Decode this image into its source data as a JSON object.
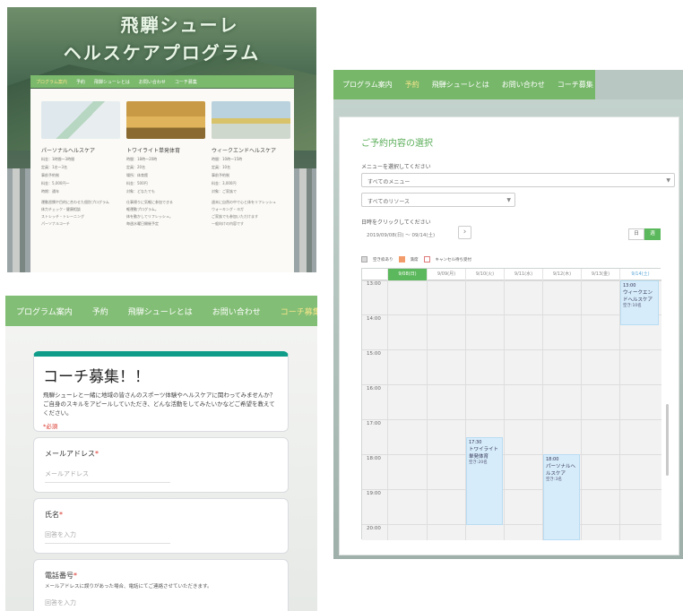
{
  "panel1": {
    "hero_line1": "飛騨シューレ",
    "hero_line2": "ヘルスケアプログラム",
    "nav": [
      "プログラム案内",
      "予約",
      "飛騨シューレとは",
      "お問い合わせ",
      "コーチ募集"
    ],
    "cards": [
      {
        "title": "パーソナルヘルスケア",
        "info": [
          "料金：1時間〜3時間",
          "定員：1名〜3名",
          "事前予約制",
          "料金：5,000円〜",
          "時期：通年"
        ],
        "desc": [
          "運動習慣や目的に合わせた個別プログラム",
          "体力チェック・健康相談",
          "ストレッチ・トレーニング",
          "パーソナルコーチ"
        ]
      },
      {
        "title": "トワイライト単発体育",
        "info": [
          "時間：18時〜20時",
          "定員：20名",
          "場所：体育館",
          "料金：500円",
          "対象：どなたでも"
        ],
        "desc": [
          "仕事帰りに気軽に参加できる",
          "軽運動プログラム。",
          "体を動かしてリフレッシュ。",
          "毎週水曜日開催予定"
        ]
      },
      {
        "title": "ウィークエンドヘルスケア",
        "info": [
          "時間：10時〜15時",
          "定員：10名",
          "事前予約制",
          "料金：3,000円",
          "対象：ご家族で"
        ],
        "desc": [
          "週末に自然の中で心と体をリフレッシュ",
          "ウォーキング・ヨガ",
          "ご家族でも参加いただけます",
          "一般向けの内容です"
        ]
      }
    ]
  },
  "panel2": {
    "nav": [
      "プログラム案内",
      "予約",
      "飛騨シューレとは",
      "お問い合わせ",
      "コーチ募集"
    ],
    "form_title": "コーチ募集！！",
    "form_desc": "飛騨シューレと一緒に地域の皆さんのスポーツ体験やヘルスケアに関わってみませんか？ ご自身のスキルをアピールしていただき、どんな活動をしてみたいかなどご希望を教えてください。",
    "required_note": "*必須",
    "fields": [
      {
        "label": "メールアドレス",
        "required": "*",
        "placeholder": "メールアドレス",
        "hint": ""
      },
      {
        "label": "氏名",
        "required": "*",
        "placeholder": "回答を入力",
        "hint": ""
      },
      {
        "label": "電話番号",
        "required": "*",
        "placeholder": "回答を入力",
        "hint": "メールアドレスに誤りがあった場合、電話にてご連絡させていただきます。"
      }
    ]
  },
  "panel3": {
    "nav": [
      "プログラム案内",
      "予約",
      "飛騨シューレとは",
      "お問い合わせ",
      "コーチ募集"
    ],
    "heading": "ご予約内容の選択",
    "menu_label": "メニューを選択してください",
    "menu_select": "すべてのメニュー",
    "resource_select": "すべてのリソース",
    "date_label": "日時をクリックしてください",
    "date_range": "2019/09/08(日) 〜 09/14(土)",
    "view_day": "日",
    "view_week": "週",
    "legend": [
      "空き枠あり",
      "満席",
      "キャンセル待ち受付"
    ],
    "days": [
      "9/08(日)",
      "9/09(月)",
      "9/10(火)",
      "9/11(水)",
      "9/12(木)",
      "9/13(金)",
      "9/14(土)"
    ],
    "times": [
      "13:00",
      "14:00",
      "15:00",
      "16:00",
      "17:00",
      "18:00",
      "19:00",
      "20:00"
    ],
    "events": [
      {
        "time": "13:00",
        "title": "ウィークエンドヘルスケア",
        "note": "空き:10名"
      },
      {
        "time": "17:30",
        "title": "トワイライト単発体育",
        "note": "空き:20名"
      },
      {
        "time": "18:00",
        "title": "パーソナルヘルスケア",
        "note": "空き:3名"
      }
    ],
    "colors": {
      "accent": "#77b76a",
      "event": "#d6ecfa",
      "week_btn": "#5cb85c"
    }
  }
}
